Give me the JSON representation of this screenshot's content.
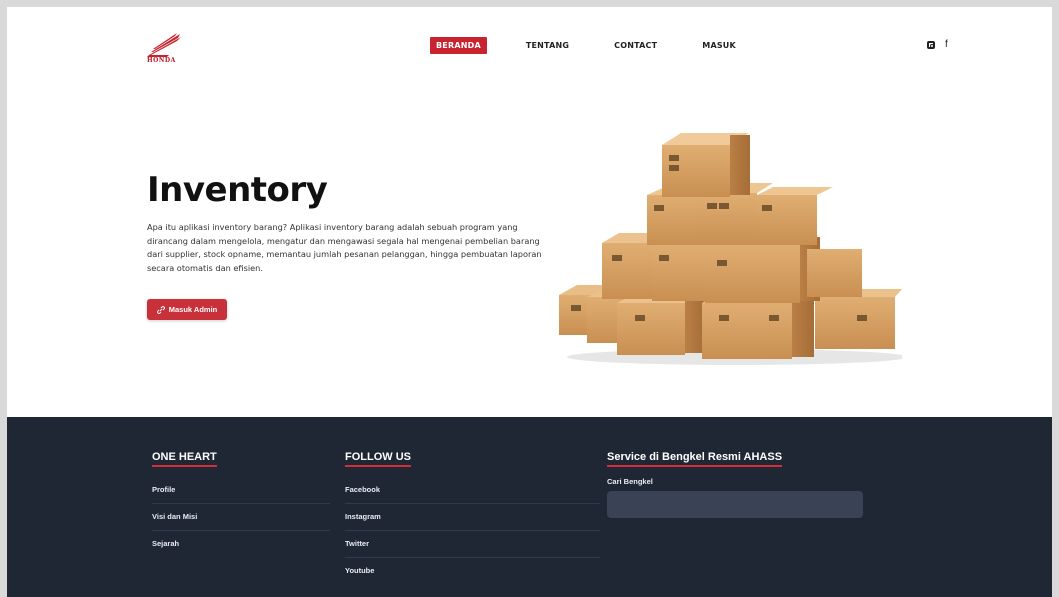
{
  "brand": {
    "logo_text": "HONDA",
    "accent": "#c8242f"
  },
  "nav": {
    "items": [
      {
        "label": "BERANDA",
        "active": true
      },
      {
        "label": "TENTANG",
        "active": false
      },
      {
        "label": "CONTACT",
        "active": false
      },
      {
        "label": "MASUK",
        "active": false
      }
    ],
    "social": [
      {
        "icon": "instagram-icon"
      },
      {
        "icon": "facebook-icon",
        "glyph": "f"
      }
    ]
  },
  "hero": {
    "title": "Inventory",
    "description": "Apa itu aplikasi inventory barang? Aplikasi inventory barang adalah sebuah program yang dirancang dalam mengelola, mengatur dan mengawasi segala hal mengenai pembelian barang dari supplier, stock opname, memantau jumlah pesanan pelanggan, hingga pembuatan laporan secara otomatis dan efisien.",
    "cta_label": "Masuk Admin",
    "cta_icon": "link-icon"
  },
  "footer": {
    "bg": "#1f2634",
    "col1": {
      "title": "ONE HEART",
      "links": [
        "Profile",
        "Visi dan Misi",
        "Sejarah"
      ]
    },
    "col2": {
      "title": "FOLLOW US",
      "links": [
        "Facebook",
        "Instagram",
        "Twitter",
        "Youtube"
      ]
    },
    "col3": {
      "title": "Service di Bengkel Resmi AHASS",
      "label": "Cari Bengkel",
      "placeholder": ""
    }
  }
}
